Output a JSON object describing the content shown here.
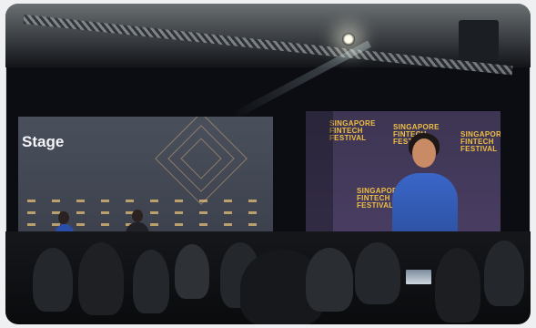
{
  "scene": {
    "stage_screen_label": "Stage",
    "right_screen": {
      "logo_lines": [
        "SINGAPORE",
        "FINTECH",
        "FESTIVAL"
      ]
    }
  }
}
